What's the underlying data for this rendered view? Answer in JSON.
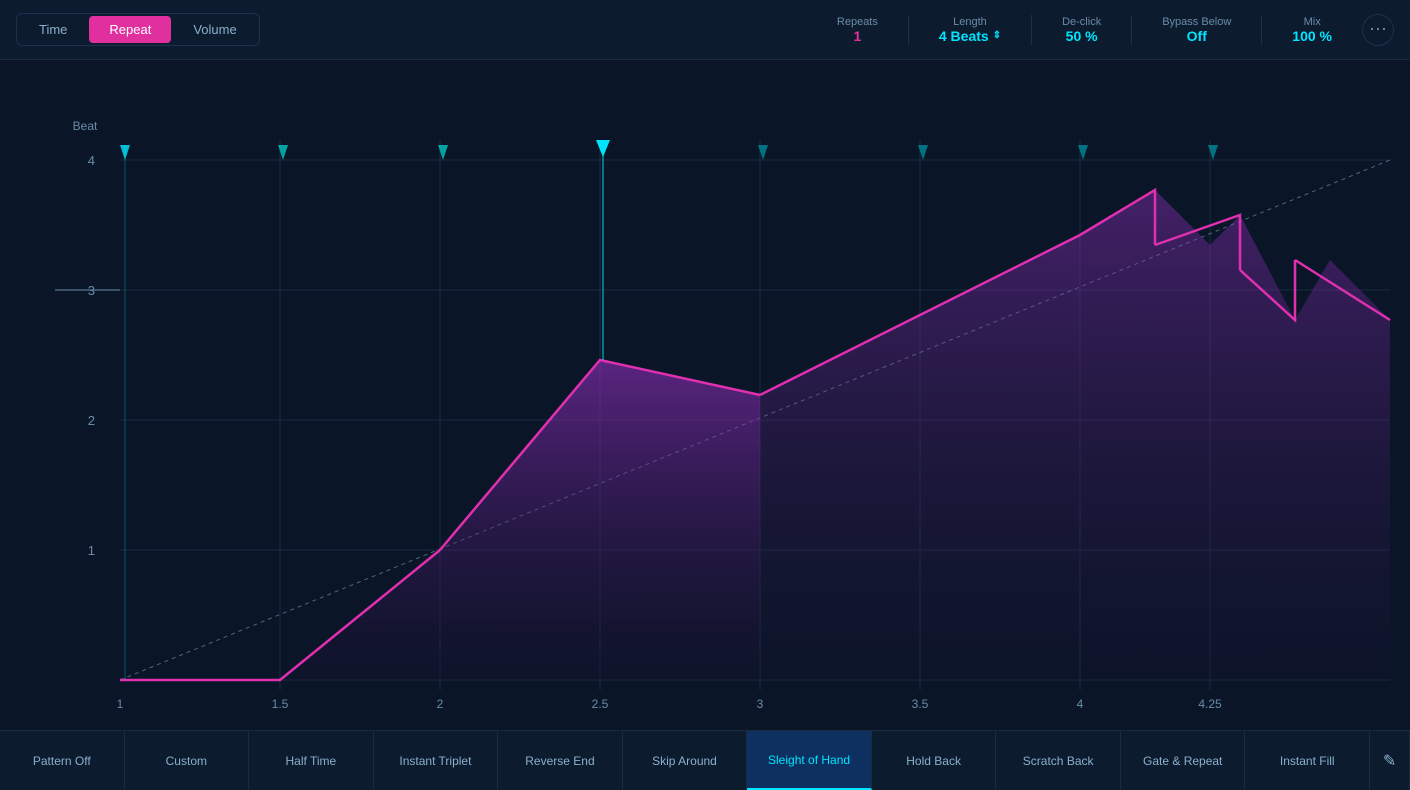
{
  "header": {
    "tabs": [
      {
        "label": "Time",
        "active": false
      },
      {
        "label": "Repeat",
        "active": true
      },
      {
        "label": "Volume",
        "active": false
      }
    ],
    "repeats_label": "Repeats",
    "repeats_value": "1",
    "length_label": "Length",
    "length_value": "4 Beats",
    "declick_label": "De-click",
    "declick_value": "50 %",
    "bypass_label": "Bypass Below",
    "bypass_value": "Off",
    "mix_label": "Mix",
    "mix_value": "100 %"
  },
  "chart": {
    "beat_label": "Beat",
    "y_ticks": [
      "4",
      "3",
      "2",
      "1"
    ],
    "x_ticks": [
      "1",
      "1.5",
      "2",
      "2.5",
      "3",
      "3.5",
      "4",
      "4.25"
    ]
  },
  "bottom_bar": {
    "buttons": [
      {
        "label": "Pattern Off",
        "active": false
      },
      {
        "label": "Custom",
        "active": false
      },
      {
        "label": "Half Time",
        "active": false
      },
      {
        "label": "Instant Triplet",
        "active": false
      },
      {
        "label": "Reverse End",
        "active": false
      },
      {
        "label": "Skip Around",
        "active": false
      },
      {
        "label": "Sleight of Hand",
        "active": true
      },
      {
        "label": "Hold Back",
        "active": false
      },
      {
        "label": "Scratch Back",
        "active": false
      },
      {
        "label": "Gate & Repeat",
        "active": false
      },
      {
        "label": "Instant Fill",
        "active": false
      }
    ],
    "edit_icon": "✎"
  }
}
